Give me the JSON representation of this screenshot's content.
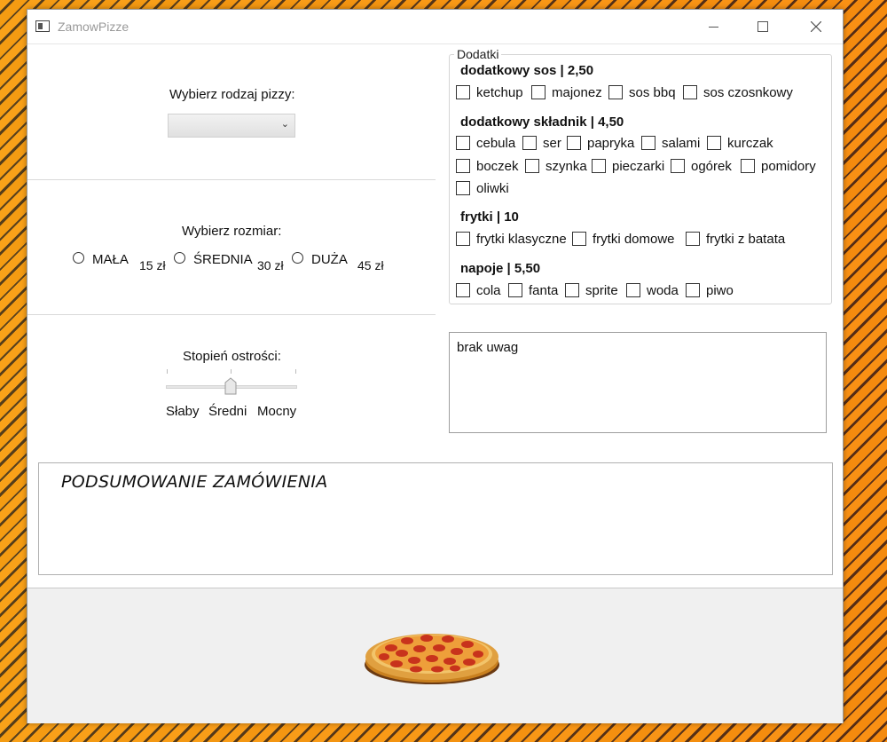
{
  "window": {
    "title": "ZamowPizze"
  },
  "pizza_type": {
    "label": "Wybierz rodzaj pizzy:",
    "selected": ""
  },
  "size": {
    "label": "Wybierz rozmiar:",
    "options": [
      {
        "name": "MAŁA",
        "price": "15 zł"
      },
      {
        "name": "ŚREDNIA",
        "price": "30 zł"
      },
      {
        "name": "DUŻA",
        "price": "45 zł"
      }
    ]
  },
  "spice": {
    "label": "Stopień ostrości:",
    "levels": [
      "Słaby",
      "Średni",
      "Mocny"
    ],
    "value": "Średni"
  },
  "extras": {
    "title": "Dodatki",
    "groups": [
      {
        "title": "dodatkowy sos | 2,50",
        "items": [
          "ketchup",
          "majonez",
          "sos bbq",
          "sos czosnkowy"
        ]
      },
      {
        "title": "dodatkowy składnik | 4,50",
        "items": [
          "cebula",
          "ser",
          "papryka",
          "salami",
          "kurczak",
          "boczek",
          "szynka",
          "pieczarki",
          "ogórek",
          "pomidory",
          "oliwki"
        ]
      },
      {
        "title": "frytki | 10",
        "items": [
          "frytki klasyczne",
          "frytki domowe",
          "frytki z batata"
        ]
      },
      {
        "title": "napoje | 5,50",
        "items": [
          "cola",
          "fanta",
          "sprite",
          "woda",
          "piwo"
        ]
      }
    ]
  },
  "notes": {
    "value": "brak uwag"
  },
  "summary": {
    "title": "PODSUMOWANIE ZAMÓWIENIA"
  },
  "image": {
    "icon": "pizza-icon"
  }
}
